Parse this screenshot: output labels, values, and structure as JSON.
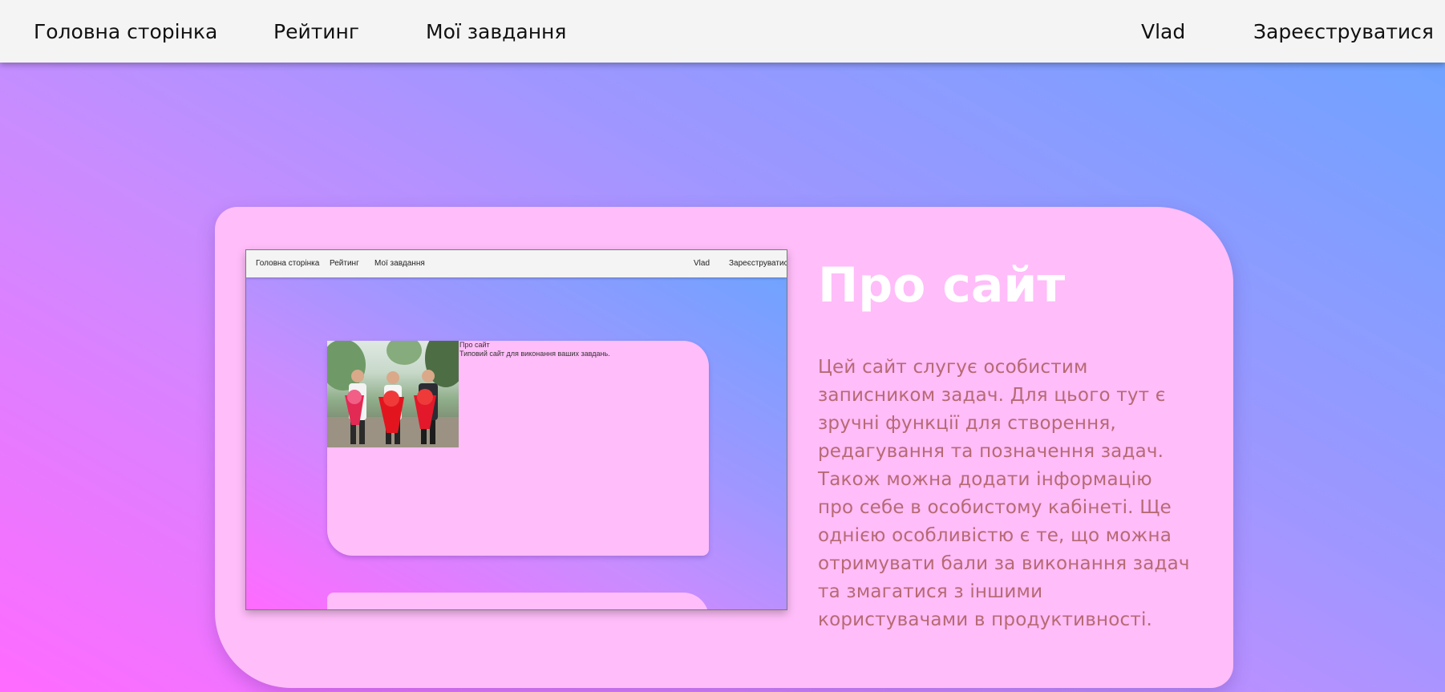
{
  "nav": {
    "home": "Головна сторінка",
    "rating": "Рейтинг",
    "tasks": "Мої завдання",
    "user": "Vlad",
    "register": "Зареєструватися"
  },
  "about": {
    "title": "Про сайт",
    "text": "Цей сайт слугує особистим записником задач. Для цього тут є зручні функції для створення, редагування та позначення задач. Також можна додати інформацію про себе в особистому кабінеті. Ще однією особливістю є те, що можна отримувати бали за виконання задач та змагатися з іншими користувачами в продуктивності."
  },
  "preview": {
    "nav": {
      "home": "Головна сторінка",
      "rating": "Рейтинг",
      "tasks": "Мої завдання",
      "user": "Vlad",
      "register": "Зареєструватися"
    },
    "card_title": "Про сайт",
    "card_text": "Типовий сайт для виконання ваших завдань."
  },
  "colors": {
    "card_bg": "#ffbdf9",
    "title_color": "#ffffff",
    "text_color": "#b66a74",
    "topbar_bg": "#f4f4f4",
    "gradient_pink": "#ff6bff",
    "gradient_blue": "#6ba4ff"
  }
}
